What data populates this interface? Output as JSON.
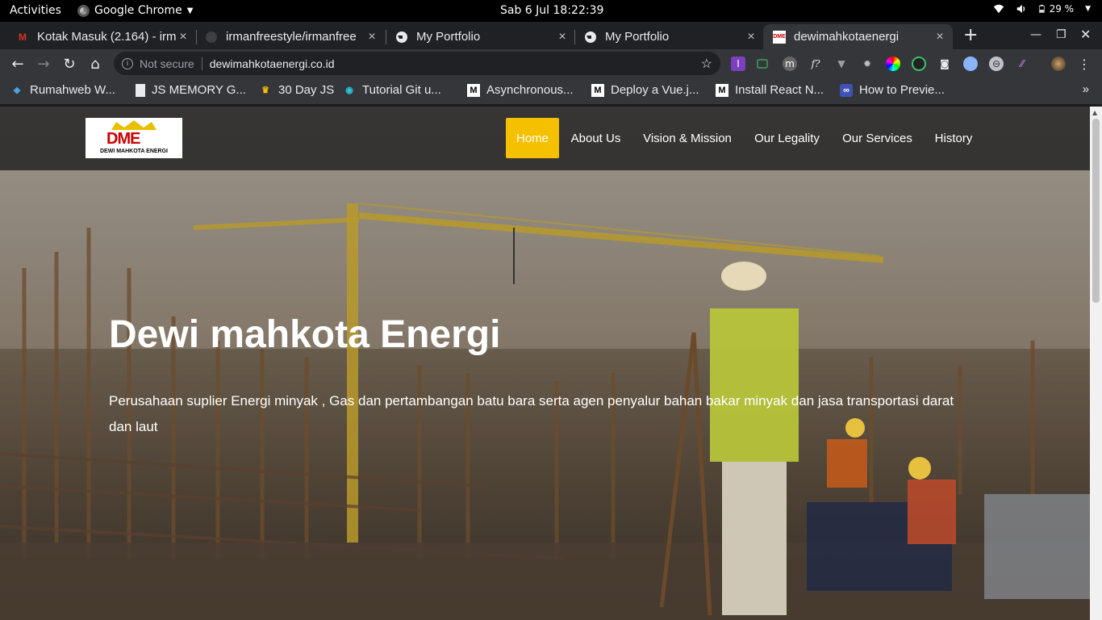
{
  "gnome": {
    "activities": "Activities",
    "app": "Google Chrome",
    "clock": "Sab  6 Jul  18:22:39",
    "battery": "29 %"
  },
  "tabs": [
    {
      "label": "Kotak Masuk (2.164) - irm",
      "icon": "gmail-icon"
    },
    {
      "label": "irmanfreestyle/irmanfree",
      "icon": "github-icon"
    },
    {
      "label": "My Portfolio",
      "icon": "globe-icon"
    },
    {
      "label": "My Portfolio",
      "icon": "globe-icon"
    },
    {
      "label": "dewimahkotaenergi",
      "icon": "dme-favicon"
    }
  ],
  "omnibox": {
    "security": "Not secure",
    "url": "dewimahkotaenergi.co.id"
  },
  "bookmarks": [
    {
      "label": "Rumahweb W...",
      "icon": "rumahweb-icon"
    },
    {
      "label": "JS MEMORY G...",
      "icon": "doc-icon"
    },
    {
      "label": "30 Day JS",
      "icon": "crown-icon"
    },
    {
      "label": "Tutorial Git u...",
      "icon": "compass-icon"
    },
    {
      "label": "Asynchronous...",
      "icon": "medium-icon"
    },
    {
      "label": "Deploy a Vue.j...",
      "icon": "medium-icon"
    },
    {
      "label": "Install React N...",
      "icon": "medium-icon"
    },
    {
      "label": "How to Previe...",
      "icon": "infinity-icon"
    }
  ],
  "site": {
    "logo_text": "DME",
    "logo_sub": "DEWI MAHKOTA ENERGI",
    "menu": [
      "Home",
      "About Us",
      "Vision & Mission",
      "Our Legality",
      "Our Services",
      "History"
    ],
    "active_menu": "Home",
    "accent": "#f5c000",
    "hero_title": "Dewi mahkota Energi",
    "hero_desc": "Perusahaan suplier Energi minyak , Gas dan pertambangan batu bara serta agen penyalur bahan bakar minyak dan jasa transportasi darat dan laut"
  }
}
